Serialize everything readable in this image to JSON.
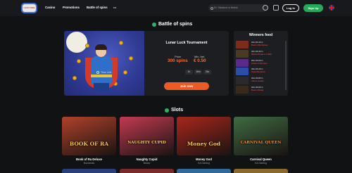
{
  "header": {
    "logo_text": "LUCKY RIDE",
    "nav": [
      "Casino",
      "Promotions",
      "Battle of spins"
    ],
    "more": "•••",
    "search_placeholder": "Ex: Starburst or Netent",
    "login_label": "Log In",
    "signup_label": "Sign Up"
  },
  "battle": {
    "section_title": "Battle of spins",
    "tournament_name": "Lunar Luck Tournament",
    "prize_label": "Prize",
    "prize_value": "300 spins",
    "min_bet_label": "Min. bet",
    "min_bet_value": "€ 0.50",
    "time_left_label": "Time Left:",
    "time_boxes": [
      "1h",
      "16m",
      "24s"
    ],
    "join_label": "Join now"
  },
  "winners": {
    "title": "Winners feed",
    "rows": [
      {
        "line1": "Won €1.00 in",
        "line2": "Book of Ra Deluxe",
        "color": "#7a2d1a"
      },
      {
        "line1": "Won €0.40 in",
        "line2": "Wanted Dead or a Wild",
        "color": "#4a3a20"
      },
      {
        "line1": "Won €3.00 in",
        "line2": "Gates of Olympus",
        "color": "#5b2a8a"
      },
      {
        "line1": "Won €0.25 in",
        "line2": "Sweet Bonanza",
        "color": "#2a4fa8"
      },
      {
        "line1": "Won €0.80 in",
        "line2": "Jokers Jewels",
        "color": "#2a2a2a"
      },
      {
        "line1": "Won €0.60 in",
        "line2": "Book of Dead",
        "color": "#3a2a1a"
      }
    ]
  },
  "slots": {
    "section_title": "Slots",
    "games": [
      {
        "title": "Book of Ra Deluxe",
        "provider": "Novomatic",
        "logo": "BOOK OF RA",
        "bg": "#b0422a",
        "logo_color": "#f5c642"
      },
      {
        "title": "Naughty Cupid",
        "provider": "Beano",
        "logo": "NAUGHTY CUPID",
        "bg": "#c33a52",
        "logo_color": "#ffd35a"
      },
      {
        "title": "Money God",
        "provider": "KA Gaming",
        "logo": "Money God",
        "bg": "#a8261c",
        "logo_color": "#ffcc33"
      },
      {
        "title": "Carnival Queen",
        "provider": "KA Gaming",
        "logo": "CARNIVAL QUEEN",
        "bg": "#3f6b43",
        "logo_color": "#ff8a2a"
      }
    ]
  },
  "colors": {
    "accent_orange": "#ee5a23",
    "signup_green": "#27a95c",
    "win_red": "#ff5151"
  }
}
